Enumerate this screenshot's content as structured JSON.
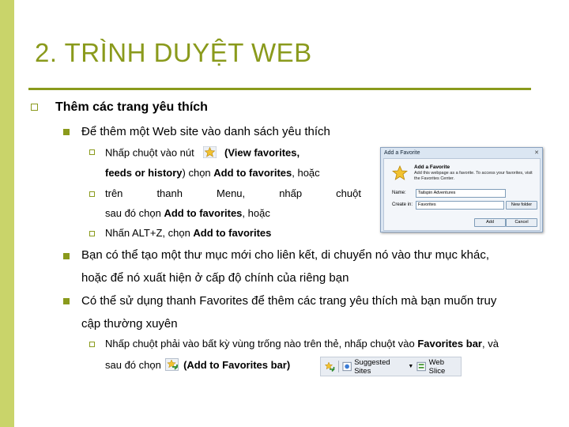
{
  "title": "2. TRÌNH DUYỆT WEB",
  "bullet1": "Thêm các trang yêu thích",
  "sub1": "Để thêm một Web site vào danh sách yêu thích",
  "item1": {
    "before": "Nhấp chuột vào nút",
    "after": "(View favorites,",
    "line2_bold1": "feeds or history",
    "line2_mid": ") chọn ",
    "line2_bold2": "Add to favorites",
    "line2_end": ", hoặc"
  },
  "item2": {
    "words": [
      "trên",
      "thanh",
      "Menu,",
      "nhấp",
      "chuột"
    ],
    "line2_pre": "sau đó chọn ",
    "line2_bold": "Add to favorites",
    "line2_end": ", hoặc"
  },
  "item3": {
    "pre": "Nhấn ALT+Z, chọn ",
    "bold": "Add to favorites"
  },
  "sub2": {
    "line1": "Bạn có thể tạo một thư mục mới cho liên kết, di chuyển nó vào thư mục khác,",
    "line2": "hoặc để nó xuất hiện ở cấp độ chính của riêng bạn"
  },
  "sub3": {
    "line1": "Có thể sử dụng thanh Favorites để thêm các trang yêu thích mà bạn muốn truy",
    "line2": "cập thường xuyên"
  },
  "item4": {
    "pre": "Nhấp chuột phải vào bất kỳ vùng trống nào trên thẻ, nhấp chuột vào ",
    "bold": "Favorites bar",
    "end": ", và",
    "line2_pre": "sau đó chọn",
    "line2_bold": "(Add to Favorites bar)"
  },
  "dialog": {
    "title": "Add a Favorite",
    "close": "✕",
    "heading": "Add a Favorite",
    "desc": "Add this webpage as a favorite. To access your favorites, visit the Favorites Center.",
    "name_label": "Name:",
    "name_value": "Tailspin Adventures",
    "create_label": "Create in:",
    "create_value": "Favorites",
    "new_folder": "New folder",
    "add": "Add",
    "cancel": "Cancel"
  },
  "toolbar": {
    "suggested": "Suggested Sites",
    "web_slice": "Web Slice"
  },
  "colors": {
    "accent": "#8a9a1c",
    "leftbar": "#c9d46a"
  }
}
